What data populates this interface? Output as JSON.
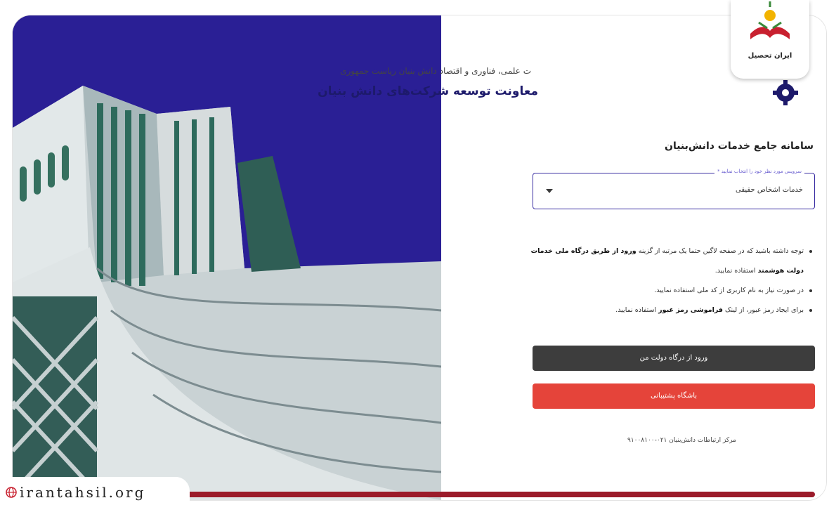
{
  "brand": {
    "name": "ایران تحصیل",
    "site": "irantahsil.org"
  },
  "org": {
    "subtitle": "ت علمی، فناوری و اقتصاد دانش بنیان ریاست جمهوری",
    "title": "معاونت توسعه شرکت‌های دانش بنیان"
  },
  "system": {
    "title": "سامانه جامع خدمات دانش‌بنیان"
  },
  "service_select": {
    "legend": "سرویس مورد نظر خود را انتخاب نمایید *",
    "value": "خدمات اشخاص حقیقی"
  },
  "notes": {
    "n1_a": "توجه داشته باشید که در صفحه لاگین حتما یک مرتبه از گزینه ",
    "n1_b": "ورود از طریق درگاه ملی خدمات دولت هوشمند",
    "n1_c": " استفاده نمایید.",
    "n2": "در صورت نیاز به نام کاربری از کد ملی استفاده نمایید.",
    "n3_a": "برای ایجاد رمز عبور، از لینک ",
    "n3_b": "فراموشی رمز عبور",
    "n3_c": " استفاده نمایید."
  },
  "buttons": {
    "gov_login": "ورود از درگاه دولت من",
    "support_club": "باشگاه پشتیبانی"
  },
  "contact": "مرکز ارتباطات دانش‌بنیان ۰۲۱-۹۱۰۰۸۱۰۰",
  "colors": {
    "sky": "#2a1f95",
    "accent": "#3b2fa3",
    "danger": "#e5443a",
    "dark": "#3d3d3d",
    "bar": "#9b1b2a"
  }
}
